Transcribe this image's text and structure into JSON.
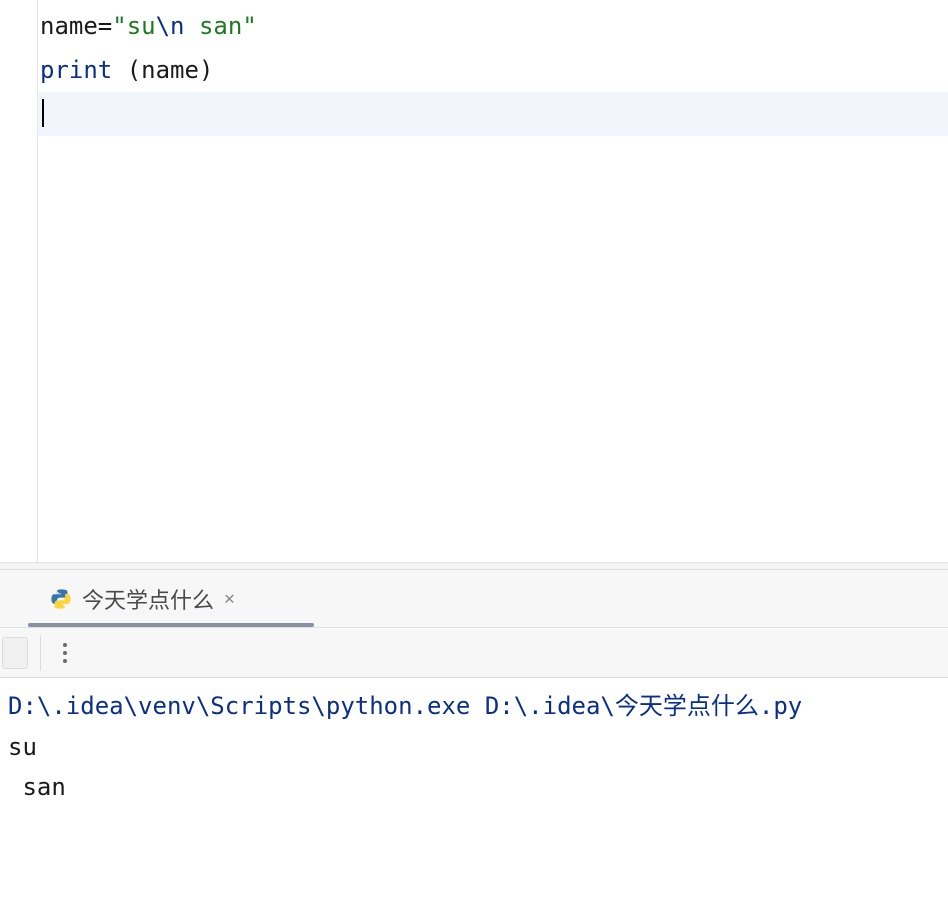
{
  "editor": {
    "line1": {
      "name": "name",
      "eq": "=",
      "q1": "\"",
      "s1": "su",
      "esc": "\\n",
      "s2": " san",
      "q2": "\""
    },
    "line2": {
      "print": "print",
      "sp": " ",
      "lp": "(",
      "arg": "name",
      "rp": ")"
    }
  },
  "runTab": {
    "label": "今天学点什么"
  },
  "console": {
    "cmd_prefix": "D:\\.idea\\venv\\Scripts\\python.exe D:\\.idea\\",
    "cmd_cjk": "今天学点什么",
    "cmd_suffix": ".py",
    "out1": "su",
    "out2": " san"
  }
}
